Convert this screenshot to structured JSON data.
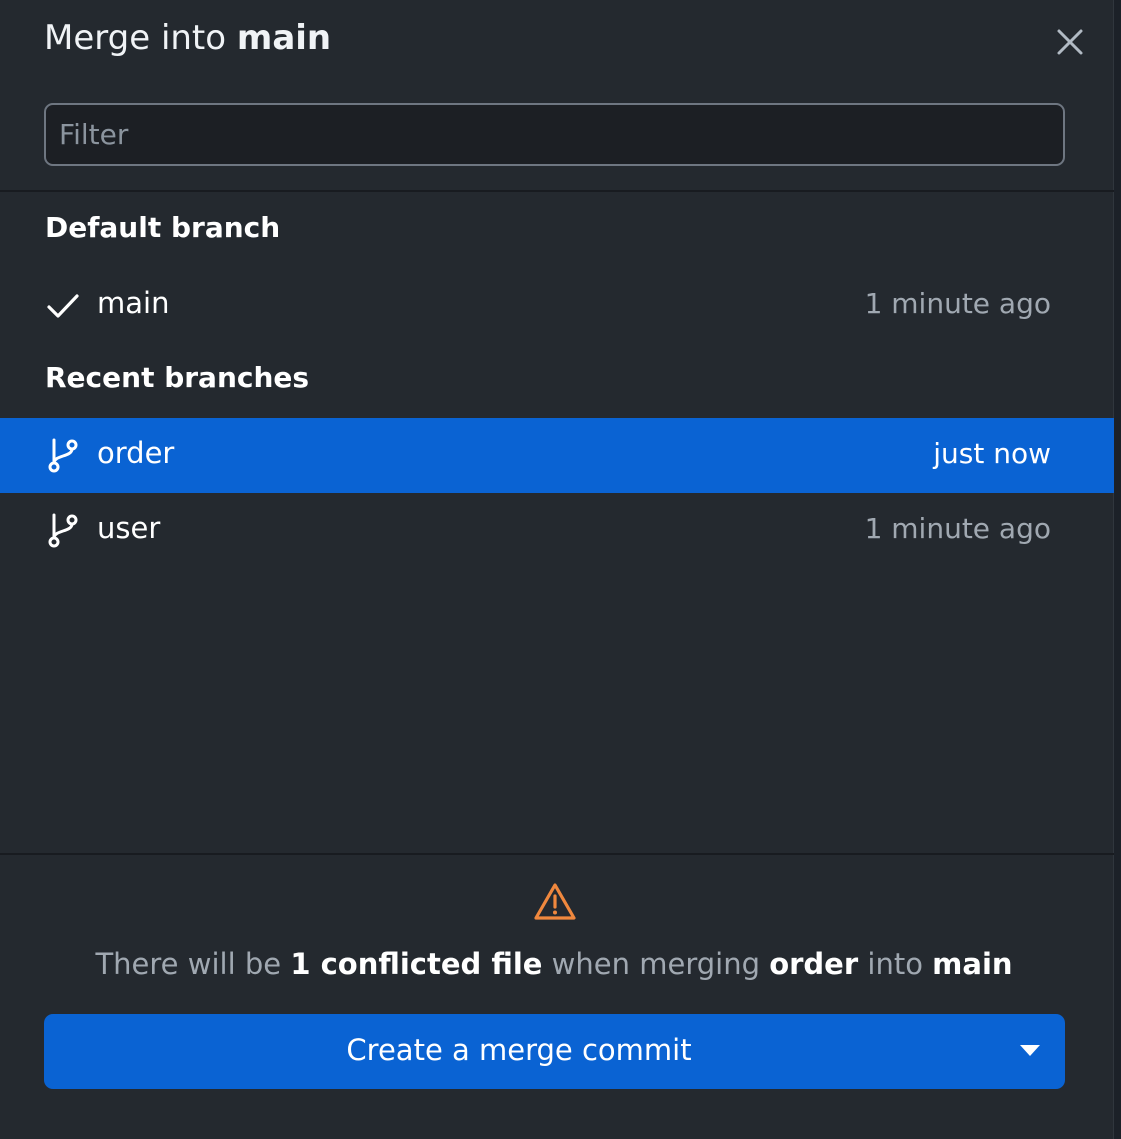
{
  "dialog": {
    "title_prefix": "Merge into ",
    "title_branch": "main",
    "close_icon": "close-icon"
  },
  "filter": {
    "placeholder": "Filter",
    "value": ""
  },
  "default_section": {
    "heading": "Default branch",
    "items": [
      {
        "name": "main",
        "time": "1 minute ago",
        "icon": "check-icon"
      }
    ]
  },
  "recent_section": {
    "heading": "Recent branches",
    "items": [
      {
        "name": "order",
        "time": "just now",
        "icon": "branch-icon",
        "selected": true
      },
      {
        "name": "user",
        "time": "1 minute ago",
        "icon": "branch-icon",
        "selected": false
      }
    ]
  },
  "footer": {
    "warning_icon": "warning-icon",
    "warning_color": "#f0883e",
    "message": {
      "part1": "There will be ",
      "count": "1 conflicted file",
      "part2": " when merging ",
      "source": "order",
      "part3": " into ",
      "target": "main"
    },
    "button_label": "Create a merge commit",
    "dropdown_icon": "caret-down-icon"
  },
  "colors": {
    "accent": "#0a63d3",
    "background": "#24292f",
    "muted_text": "#a0a8b1"
  }
}
